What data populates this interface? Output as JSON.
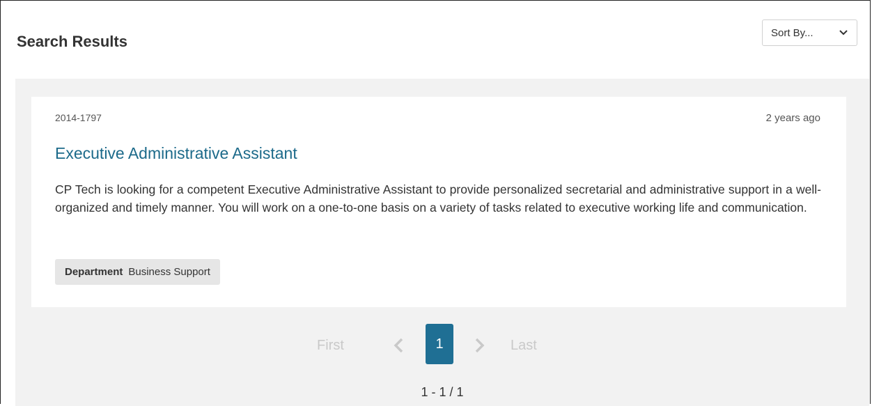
{
  "header": {
    "title": "Search Results",
    "sort": {
      "label": "Sort By..."
    }
  },
  "results": [
    {
      "id": "2014-1797",
      "posted": "2 years ago",
      "title": "Executive Administrative Assistant",
      "description": "CP Tech is looking for a competent Executive Administrative Assistant to provide personalized secretarial and administrative support in a well-organized and timely manner. You will work on a one-to-one basis on a variety of tasks related to executive working life and communication.",
      "tag": {
        "label": "Department",
        "value": "Business Support"
      }
    }
  ],
  "pagination": {
    "first": "First",
    "current": "1",
    "last": "Last",
    "count": "1 - 1 / 1"
  },
  "colors": {
    "accent": "#1f6f94",
    "link": "#1c6a8a",
    "disabled": "#c9c9c9",
    "results_bg": "#f2f2f2",
    "tag_bg": "#e6e6e6"
  },
  "icons": {
    "sort": "chevron-down-icon",
    "prev": "chevron-left-icon",
    "next": "chevron-right-icon"
  }
}
